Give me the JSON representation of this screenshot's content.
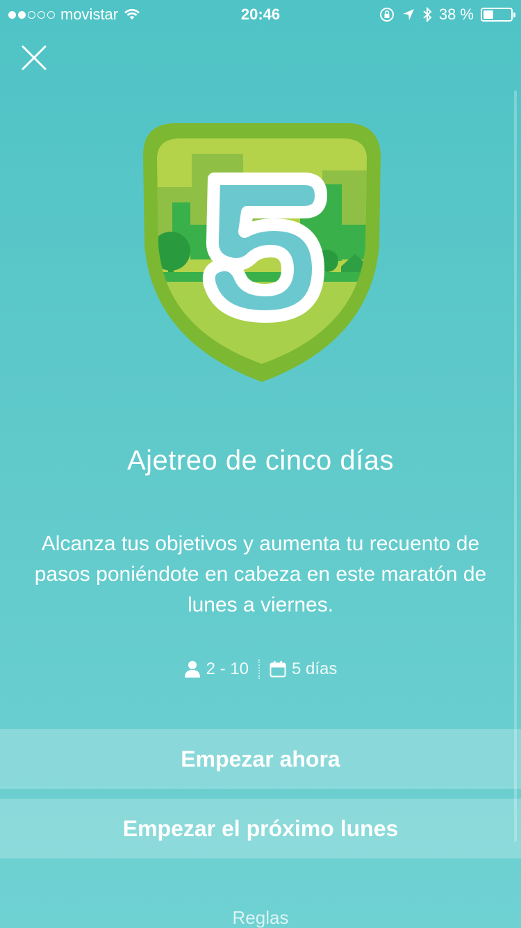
{
  "status_bar": {
    "carrier": "movistar",
    "time": "20:46",
    "battery_percent": "38 %",
    "battery_level": 0.38,
    "signal_filled": 2,
    "signal_total": 5
  },
  "challenge": {
    "badge_number": "5",
    "title": "Ajetreo de cinco días",
    "description": "Alcanza tus objetivos y aumenta tu recuento de pasos poniéndote en cabeza en este maratón de lunes a viernes.",
    "participants": "2 - 10",
    "duration": "5 días"
  },
  "actions": {
    "start_now": "Empezar ahora",
    "start_monday": "Empezar el próximo lunes",
    "rules": "Reglas"
  },
  "colors": {
    "background": "#5fc9ca",
    "badge_outer": "#7cb832",
    "badge_inner": "#a8d04a",
    "badge_number_fill": "#6cc8cf"
  }
}
